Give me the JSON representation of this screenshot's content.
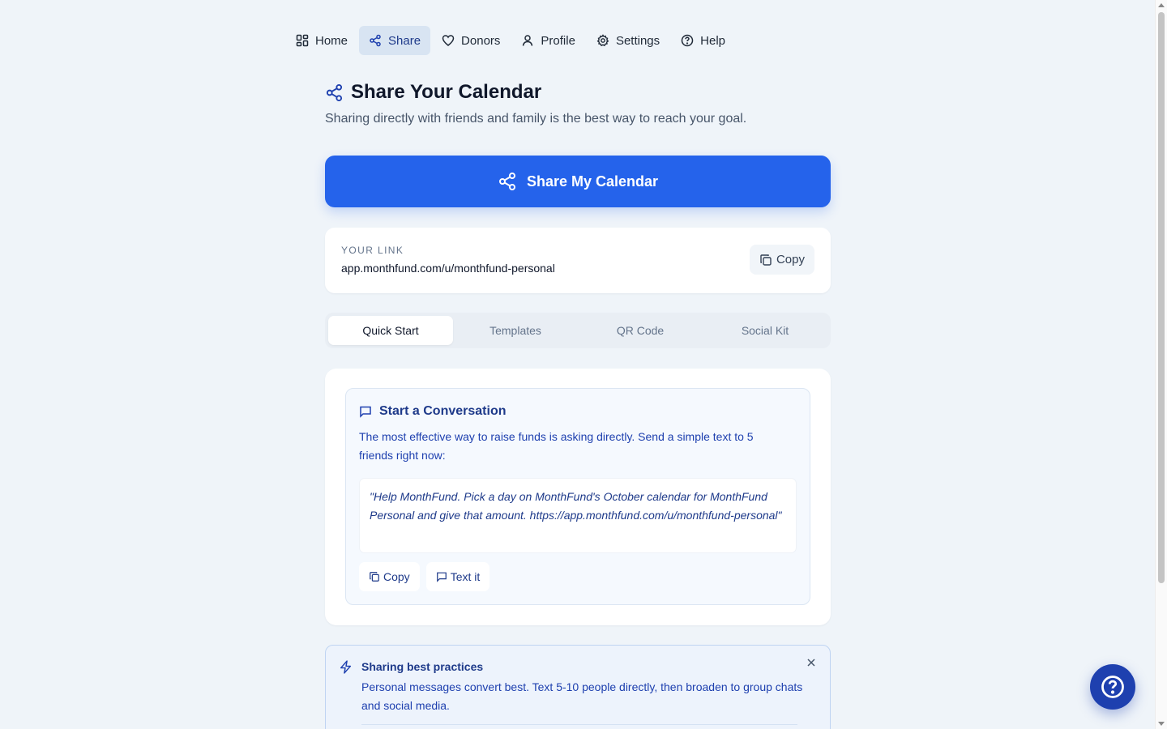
{
  "nav": {
    "items": [
      {
        "label": "Home",
        "icon": "grid-icon"
      },
      {
        "label": "Share",
        "icon": "share-icon",
        "active": true
      },
      {
        "label": "Donors",
        "icon": "heart-icon"
      },
      {
        "label": "Profile",
        "icon": "user-icon"
      },
      {
        "label": "Settings",
        "icon": "gear-icon"
      },
      {
        "label": "Help",
        "icon": "help-circle-icon"
      }
    ]
  },
  "header": {
    "title": "Share Your Calendar",
    "subtitle": "Sharing directly with friends and family is the best way to reach your goal."
  },
  "share_button": {
    "label": "Share My Calendar"
  },
  "link_card": {
    "label": "YOUR LINK",
    "url": "app.monthfund.com/u/monthfund-personal",
    "copy_label": "Copy"
  },
  "tabs": [
    {
      "label": "Quick Start",
      "active": true
    },
    {
      "label": "Templates"
    },
    {
      "label": "QR Code"
    },
    {
      "label": "Social Kit"
    }
  ],
  "conversation": {
    "title": "Start a Conversation",
    "description": "The most effective way to raise funds is asking directly. Send a simple text to 5 friends right now:",
    "message": "\"Help MonthFund. Pick a day on MonthFund's October calendar for MonthFund Personal and give that amount. https://app.monthfund.com/u/monthfund-personal\"",
    "copy_label": "Copy",
    "text_label": "Text it"
  },
  "tips": {
    "title": "Sharing best practices",
    "text": "Personal messages convert best. Text 5-10 people directly, then broaden to group chats and social media."
  },
  "colors": {
    "accent": "#2563eb",
    "accent_dark": "#1e40af",
    "background": "#eff4f9"
  }
}
